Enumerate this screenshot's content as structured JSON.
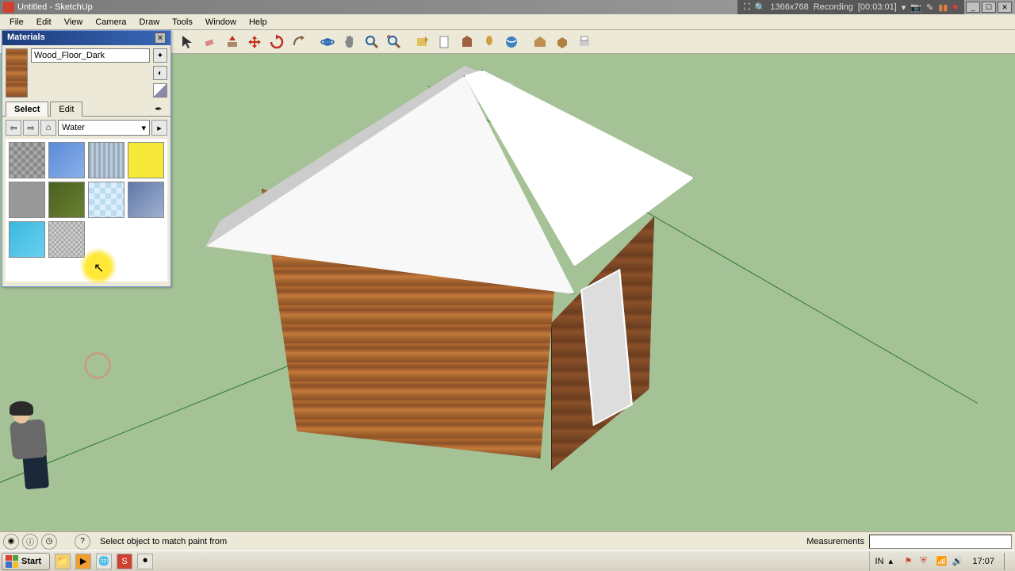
{
  "window": {
    "title": "Untitled - SketchUp",
    "recording": {
      "resolution": "1366x768",
      "label": "Recording",
      "time": "[00:03:01]"
    }
  },
  "menu": {
    "items": [
      "File",
      "Edit",
      "View",
      "Camera",
      "Draw",
      "Tools",
      "Window",
      "Help"
    ]
  },
  "materials": {
    "panel_title": "Materials",
    "current_name": "Wood_Floor_Dark",
    "tabs": {
      "select": "Select",
      "edit": "Edit"
    },
    "category": "Water"
  },
  "statusbar": {
    "hint": "Select object to match paint from",
    "measurements_label": "Measurements"
  },
  "taskbar": {
    "start": "Start",
    "lang": "IN",
    "clock": "17:07"
  }
}
